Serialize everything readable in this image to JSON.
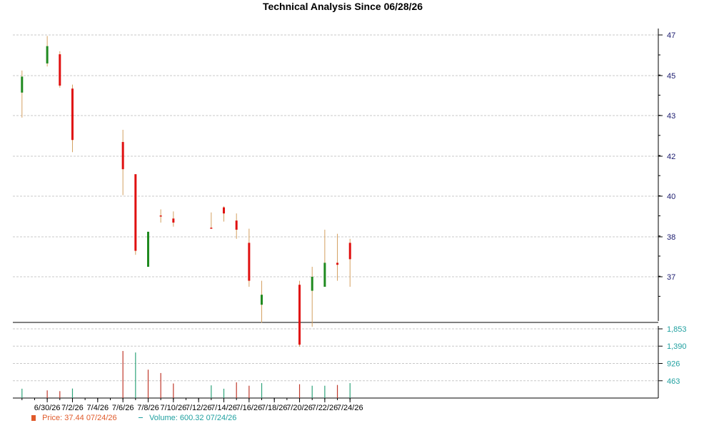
{
  "chart_data": {
    "type": "candlestick",
    "title": "Technical Analysis Since 06/28/26",
    "xlabel": "",
    "ylabel": "",
    "x_tick_labels": [
      "6/30/26",
      "7/2/26",
      "7/4/26",
      "7/6/26",
      "7/8/26",
      "7/10/26",
      "7/12/26",
      "7/14/26",
      "7/16/26",
      "7/18/26",
      "7/20/26",
      "7/22/26",
      "7/24/26"
    ],
    "x_ticks_dates": [
      "6/30",
      "7/2",
      "7/4",
      "7/6",
      "7/8",
      "7/10",
      "7/12",
      "7/14",
      "7/16",
      "7/18",
      "7/20",
      "7/22",
      "7/24"
    ],
    "price_ticks": [
      {
        "value": 47,
        "label": "47"
      },
      {
        "value": 45,
        "label": "45"
      },
      {
        "value": 43,
        "label": "43"
      },
      {
        "value": 42,
        "label": "42"
      },
      {
        "value": 40,
        "label": "40"
      },
      {
        "value": 38,
        "label": "38"
      },
      {
        "value": 37,
        "label": "37"
      }
    ],
    "volume_ticks": [
      {
        "value": 1853,
        "label": "1,853"
      },
      {
        "value": 1390,
        "label": "1,390"
      },
      {
        "value": 926,
        "label": "926"
      },
      {
        "value": 463,
        "label": "463"
      }
    ],
    "price_series": [
      {
        "date": "6/28",
        "open": 44.15,
        "high": 45.25,
        "low": 42.95,
        "close": 44.95
      },
      {
        "date": "6/30",
        "open": 45.6,
        "high": 46.95,
        "low": 45.45,
        "close": 46.45
      },
      {
        "date": "7/1",
        "open": 46.05,
        "high": 46.2,
        "low": 44.4,
        "close": 44.5
      },
      {
        "date": "7/2",
        "open": 44.35,
        "high": 44.55,
        "low": 42.1,
        "close": 42.4
      },
      {
        "date": "7/6",
        "open": 42.35,
        "high": 42.65,
        "low": 40.05,
        "close": 41.35
      },
      {
        "date": "7/7",
        "open": 41.1,
        "high": 41.1,
        "low": 37.55,
        "close": 37.65
      },
      {
        "date": "7/8",
        "open": 37.25,
        "high": 38.15,
        "low": 37.35,
        "close": 38.25
      },
      {
        "date": "7/9",
        "open": 39.05,
        "high": 39.35,
        "low": 38.7,
        "close": 39.0
      },
      {
        "date": "7/10",
        "open": 38.9,
        "high": 39.25,
        "low": 38.5,
        "close": 38.7
      },
      {
        "date": "7/13",
        "open": 38.45,
        "high": 39.2,
        "low": 38.4,
        "close": 38.4
      },
      {
        "date": "7/14",
        "open": 39.45,
        "high": 39.5,
        "low": 38.75,
        "close": 39.15
      },
      {
        "date": "7/15",
        "open": 38.8,
        "high": 39.15,
        "low": 37.95,
        "close": 38.35
      },
      {
        "date": "7/16",
        "open": 37.85,
        "high": 38.4,
        "low": 36.75,
        "close": 36.9
      },
      {
        "date": "7/17",
        "open": 36.3,
        "high": 36.9,
        "low": 35.85,
        "close": 36.55
      },
      {
        "date": "7/20",
        "open": 36.8,
        "high": 36.9,
        "low": 35.25,
        "close": 35.3
      },
      {
        "date": "7/21",
        "open": 36.65,
        "high": 37.25,
        "low": 35.75,
        "close": 37.0
      },
      {
        "date": "7/22",
        "open": 36.75,
        "high": 38.35,
        "low": 36.8,
        "close": 37.35
      },
      {
        "date": "7/23",
        "open": 37.35,
        "high": 38.15,
        "low": 36.9,
        "close": 37.3
      },
      {
        "date": "7/24",
        "open": 37.85,
        "high": 37.95,
        "low": 36.75,
        "close": 37.44
      }
    ],
    "volume_series": [
      {
        "date": "6/28",
        "value": 250,
        "direction": "up"
      },
      {
        "date": "6/30",
        "value": 205,
        "direction": "down"
      },
      {
        "date": "7/1",
        "value": 185,
        "direction": "down"
      },
      {
        "date": "7/2",
        "value": 255,
        "direction": "up"
      },
      {
        "date": "7/6",
        "value": 1260,
        "direction": "down"
      },
      {
        "date": "7/7",
        "value": 1220,
        "direction": "up"
      },
      {
        "date": "7/8",
        "value": 760,
        "direction": "down"
      },
      {
        "date": "7/9",
        "value": 670,
        "direction": "down"
      },
      {
        "date": "7/10",
        "value": 390,
        "direction": "down"
      },
      {
        "date": "7/13",
        "value": 340,
        "direction": "up"
      },
      {
        "date": "7/14",
        "value": 250,
        "direction": "up"
      },
      {
        "date": "7/15",
        "value": 420,
        "direction": "down"
      },
      {
        "date": "7/16",
        "value": 330,
        "direction": "down"
      },
      {
        "date": "7/17",
        "value": 400,
        "direction": "up"
      },
      {
        "date": "7/20",
        "value": 370,
        "direction": "down"
      },
      {
        "date": "7/21",
        "value": 330,
        "direction": "up"
      },
      {
        "date": "7/22",
        "value": 330,
        "direction": "up"
      },
      {
        "date": "7/23",
        "value": 350,
        "direction": "down"
      },
      {
        "date": "7/24",
        "value": 400,
        "direction": "up"
      }
    ],
    "colors": {
      "up": "#1f8a1f",
      "down": "#e01010",
      "wick": "#d4a060",
      "volume_up": "#2ea37a",
      "volume_down": "#c0392b",
      "grid": "#c8c8c8",
      "price_axis_text": "#1a1a6e",
      "volume_axis_text": "#20a0a0"
    },
    "legend": {
      "price_label": "Price: 37.44  07/24/26",
      "volume_label": "Volume: 600.32  07/24/26"
    },
    "grid": true
  }
}
